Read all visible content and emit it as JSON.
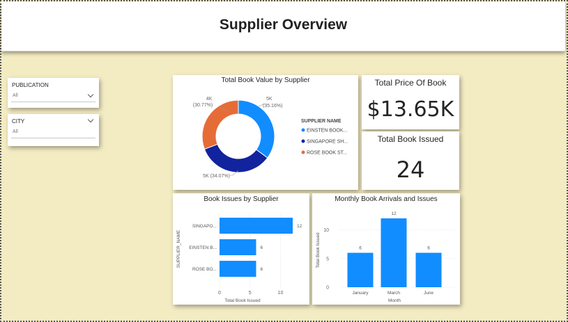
{
  "header": {
    "title": "Supplier Overview"
  },
  "slicers": [
    {
      "title": "PUBLICATION",
      "value": "All"
    },
    {
      "title": "CITY",
      "value": "All"
    }
  ],
  "kpis": {
    "total_price": {
      "title": "Total Price Of Book",
      "value": "$13.65K"
    },
    "total_issued": {
      "title": "Total Book Issued",
      "value": "24"
    }
  },
  "chart_data": [
    {
      "type": "pie",
      "title": "Total Book Value by Supplier",
      "legend_title": "SUPPLIER NAME",
      "legend_position": "right",
      "slices": [
        {
          "name": "EINSTEN BOOK...",
          "value_label": "5K",
          "percent": 35.16,
          "pct_label": "(35.16%)",
          "color": "#118dff"
        },
        {
          "name": "SINGAPORE SH...",
          "value_label": "5K",
          "percent": 34.07,
          "pct_label": "5K (34.07%)",
          "color": "#12239e"
        },
        {
          "name": "ROSE BOOK ST...",
          "value_label": "4K",
          "percent": 30.77,
          "pct_label": "(30.77%)",
          "color": "#e66c37"
        }
      ]
    },
    {
      "type": "bar",
      "orientation": "horizontal",
      "title": "Book Issues by Supplier",
      "xlabel": "Total Book Issued",
      "ylabel": "SUPPLIER_NAME",
      "categories": [
        "SINGAPO...",
        "EINSTEN B...",
        "ROSE BO..."
      ],
      "values": [
        12,
        6,
        6
      ],
      "xlim": [
        0,
        12
      ],
      "xticks": [
        0,
        5,
        10
      ],
      "color": "#118dff"
    },
    {
      "type": "bar",
      "title": "Monthly Book Arrivals and Issues",
      "xlabel": "Month",
      "ylabel": "Total Book Issued",
      "categories": [
        "January",
        "March",
        "June"
      ],
      "values": [
        6,
        12,
        6
      ],
      "ylim": [
        0,
        12
      ],
      "yticks": [
        0,
        5,
        10
      ],
      "color": "#118dff"
    }
  ]
}
